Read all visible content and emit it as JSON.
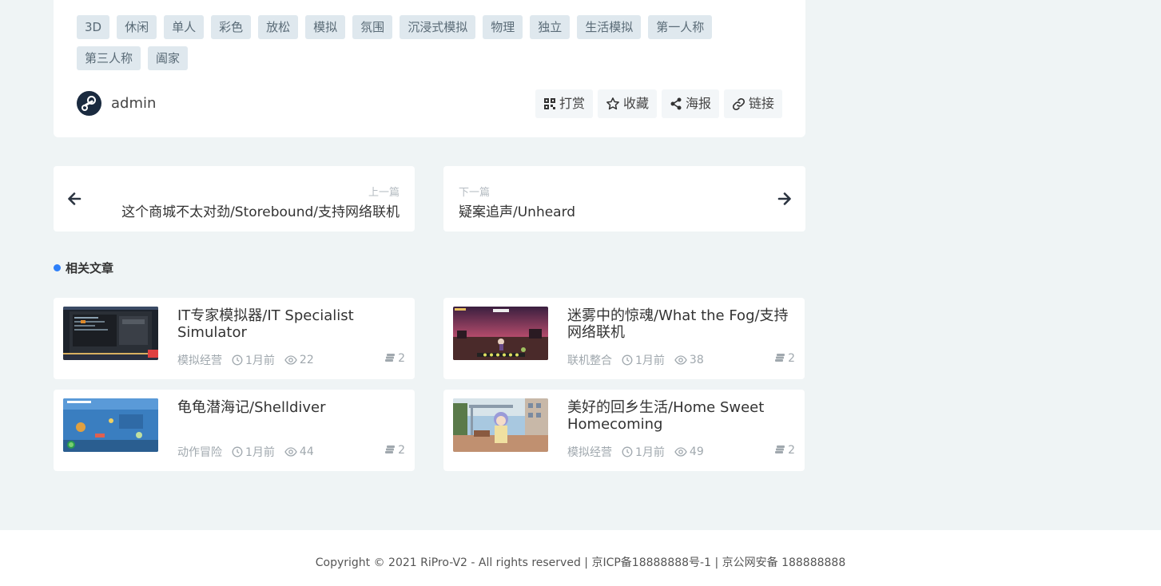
{
  "tags": [
    "3D",
    "休闲",
    "单人",
    "彩色",
    "放松",
    "模拟",
    "氛围",
    "沉浸式模拟",
    "物理",
    "独立",
    "生活模拟",
    "第一人称",
    "第三人称",
    "阖家"
  ],
  "author": {
    "name": "admin",
    "avatar_icon": "steam-icon"
  },
  "actions": [
    {
      "label": "打赏",
      "icon": "qrcode-icon"
    },
    {
      "label": "收藏",
      "icon": "star-icon"
    },
    {
      "label": "海报",
      "icon": "share-icon"
    },
    {
      "label": "链接",
      "icon": "link-icon"
    }
  ],
  "nav": {
    "prev": {
      "small": "上一篇",
      "title": "这个商城不太对劲/Storebound/支持网络联机"
    },
    "next": {
      "small": "下一篇",
      "title": "疑案追声/Unheard"
    }
  },
  "related": {
    "title": "相关文章",
    "posts": [
      {
        "title": "IT专家模拟器/IT Specialist Simulator",
        "category": "模拟经营",
        "time": "1月前",
        "views": "22",
        "count": "2"
      },
      {
        "title": "迷雾中的惊魂/What the Fog/支持网络联机",
        "category": "联机整合",
        "time": "1月前",
        "views": "38",
        "count": "2"
      },
      {
        "title": "龟龟潜海记/Shelldiver",
        "category": "动作冒险",
        "time": "1月前",
        "views": "44",
        "count": "2"
      },
      {
        "title": "美好的回乡生活/Home Sweet Homecoming",
        "category": "模拟经营",
        "time": "1月前",
        "views": "49",
        "count": "2"
      }
    ]
  },
  "footer": {
    "text": "Copyright © 2021  RiPro-V2  - All rights reserved |  京ICP备18888888号-1  |  京公网安备 188888888"
  },
  "colors": {
    "accent": "#2d7ff9",
    "background": "#eff4f5",
    "tag_bg": "#dfe8ee"
  }
}
